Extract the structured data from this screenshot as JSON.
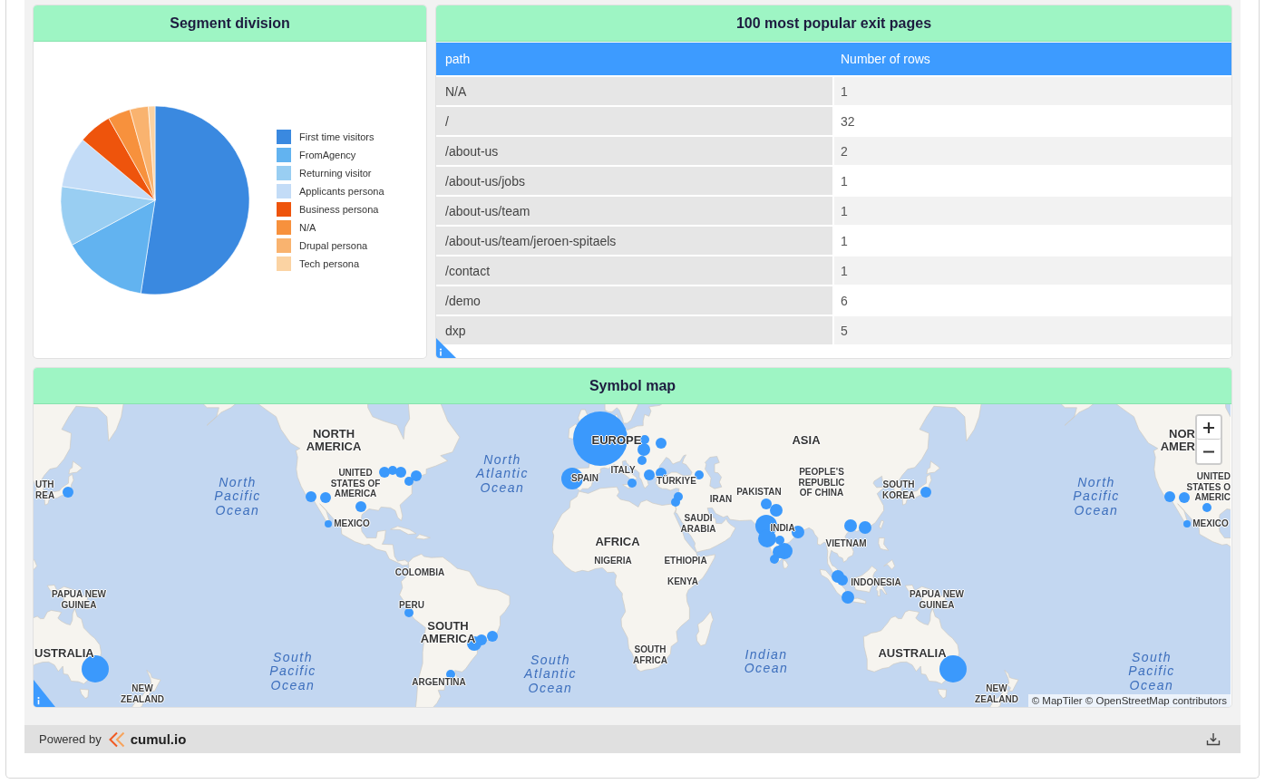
{
  "segment_card": {
    "title": "Segment division",
    "legend": [
      {
        "label": "First time visitors",
        "color": "#3a89e0"
      },
      {
        "label": "FromAgency",
        "color": "#62b3f0"
      },
      {
        "label": "Returning visitor",
        "color": "#99cef2"
      },
      {
        "label": "Applicants persona",
        "color": "#c3dcf7"
      },
      {
        "label": "Business persona",
        "color": "#ee540c"
      },
      {
        "label": "N/A",
        "color": "#f7913d"
      },
      {
        "label": "Drupal persona",
        "color": "#f9b36f"
      },
      {
        "label": "Tech persona",
        "color": "#fbd3a3"
      }
    ]
  },
  "exit_pages_card": {
    "title": "100 most popular exit pages",
    "columns": [
      "path",
      "Number of rows"
    ],
    "rows": [
      [
        "N/A",
        "1"
      ],
      [
        "/",
        "32"
      ],
      [
        "/about-us",
        "2"
      ],
      [
        "/about-us/jobs",
        "1"
      ],
      [
        "/about-us/team",
        "1"
      ],
      [
        "/about-us/team/jeroen-spitaels",
        "1"
      ],
      [
        "/contact",
        "1"
      ],
      [
        "/demo",
        "6"
      ],
      [
        "dxp",
        "5"
      ]
    ]
  },
  "map_card": {
    "title": "Symbol map",
    "labels": [
      {
        "text": "NORTH\nAMERICA",
        "kind": "continent"
      },
      {
        "text": "EUROPE",
        "kind": "continent"
      },
      {
        "text": "ASIA",
        "kind": "continent"
      },
      {
        "text": "NOR\nAMER",
        "kind": "continent"
      },
      {
        "text": "UTH\nREA",
        "kind": "country"
      },
      {
        "text": "North\nPacific\nOcean",
        "kind": "ocean"
      },
      {
        "text": "UNITED\nSTATES OF\nAMERICA",
        "kind": "country"
      },
      {
        "text": "North\nAtlantic\nOcean",
        "kind": "ocean"
      },
      {
        "text": "SPAIN",
        "kind": "country"
      },
      {
        "text": "ITALY",
        "kind": "country"
      },
      {
        "text": "TÜRKIYE",
        "kind": "country"
      },
      {
        "text": "IRAN",
        "kind": "country"
      },
      {
        "text": "PAKISTAN",
        "kind": "country"
      },
      {
        "text": "PEOPLE'S\nREPUBLIC\nOF CHINA",
        "kind": "country"
      },
      {
        "text": "SOUTH\nKOREA",
        "kind": "country"
      },
      {
        "text": "MEXICO",
        "kind": "country"
      },
      {
        "text": "SAUDI\nARABIA",
        "kind": "country"
      },
      {
        "text": "INDIA",
        "kind": "country"
      },
      {
        "text": "North\nPacific\nOcean",
        "kind": "ocean"
      },
      {
        "text": "UNITED\nSTATES O\nAMERIC",
        "kind": "country"
      },
      {
        "text": "MEXICO",
        "kind": "country"
      },
      {
        "text": "AFRICA",
        "kind": "continent"
      },
      {
        "text": "VIETNAM",
        "kind": "country"
      },
      {
        "text": "NIGERIA",
        "kind": "country"
      },
      {
        "text": "ETHIOPIA",
        "kind": "country"
      },
      {
        "text": "COLOMBIA",
        "kind": "country"
      },
      {
        "text": "KENYA",
        "kind": "country"
      },
      {
        "text": "INDONESIA",
        "kind": "country"
      },
      {
        "text": "PAPUA NEW\nGUINEA",
        "kind": "country"
      },
      {
        "text": "PERU",
        "kind": "country"
      },
      {
        "text": "PAPUA NEW\nGUINEA",
        "kind": "country"
      },
      {
        "text": "SOUTH\nAMERICA",
        "kind": "continent"
      },
      {
        "text": "USTRALIA",
        "kind": "continent"
      },
      {
        "text": "NEW\nZEALAND",
        "kind": "country"
      },
      {
        "text": "South\nPacific\nOcean",
        "kind": "ocean"
      },
      {
        "text": "ARGENTINA",
        "kind": "country"
      },
      {
        "text": "South\nAtlantic\nOcean",
        "kind": "ocean"
      },
      {
        "text": "SOUTH\nAFRICA",
        "kind": "country"
      },
      {
        "text": "Indian\nOcean",
        "kind": "ocean"
      },
      {
        "text": "AUSTRALIA",
        "kind": "continent"
      },
      {
        "text": "NEW\nZEALAND",
        "kind": "country"
      },
      {
        "text": "South\nPacific\nOcean",
        "kind": "ocean"
      }
    ],
    "attribution": "© MapTiler © OpenStreetMap contributors"
  },
  "footer": {
    "powered_by": "Powered by",
    "brand": "cumul.io"
  }
}
